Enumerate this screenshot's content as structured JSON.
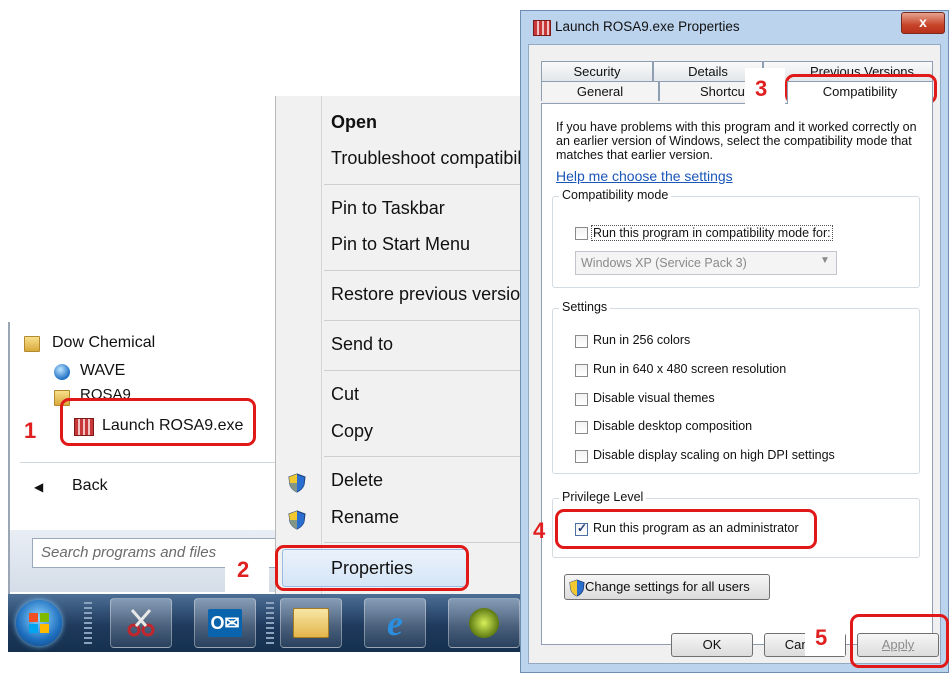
{
  "start_menu": {
    "folder_dow": "Dow Chemical",
    "item_wave": "WAVE",
    "folder_rosa": "ROSA9",
    "item_launch": "Launch ROSA9.exe",
    "back": "Back",
    "search_placeholder": "Search programs and files"
  },
  "context_menu": {
    "open": "Open",
    "troubleshoot": "Troubleshoot compatibility",
    "pin_taskbar": "Pin to Taskbar",
    "pin_start": "Pin to Start Menu",
    "restore": "Restore previous versions",
    "send_to": "Send to",
    "cut": "Cut",
    "copy": "Copy",
    "delete": "Delete",
    "rename": "Rename",
    "properties": "Properties"
  },
  "dialog": {
    "title": "Launch ROSA9.exe Properties",
    "close": "x",
    "tabs_back": [
      "Security",
      "Details",
      "Previous Versions"
    ],
    "tabs_front": [
      "General",
      "Shortcut",
      "Compatibility"
    ],
    "intro_lines": [
      "If you have problems with this program and it worked correctly on",
      "an earlier version of Windows, select the compatibility mode that",
      "matches that earlier version."
    ],
    "help_link": "Help me choose the settings",
    "compat_group": "Compatibility mode",
    "compat_checkbox": "Run this program in compatibility mode for:",
    "compat_select": "Windows XP (Service Pack 3)",
    "settings_group": "Settings",
    "settings_items": [
      "Run in 256 colors",
      "Run in 640 x 480 screen resolution",
      "Disable visual themes",
      "Disable desktop composition",
      "Disable display scaling on high DPI settings"
    ],
    "privilege_group": "Privilege Level",
    "run_admin": "Run this program as an administrator",
    "run_admin_checked": true,
    "change_all": "Change settings for all users",
    "ok": "OK",
    "cancel": "Cancel",
    "apply": "Apply"
  },
  "annotations": [
    "1",
    "2",
    "3",
    "4",
    "5"
  ],
  "colors": {
    "highlight": "#e01818",
    "link": "#1a56b8"
  }
}
